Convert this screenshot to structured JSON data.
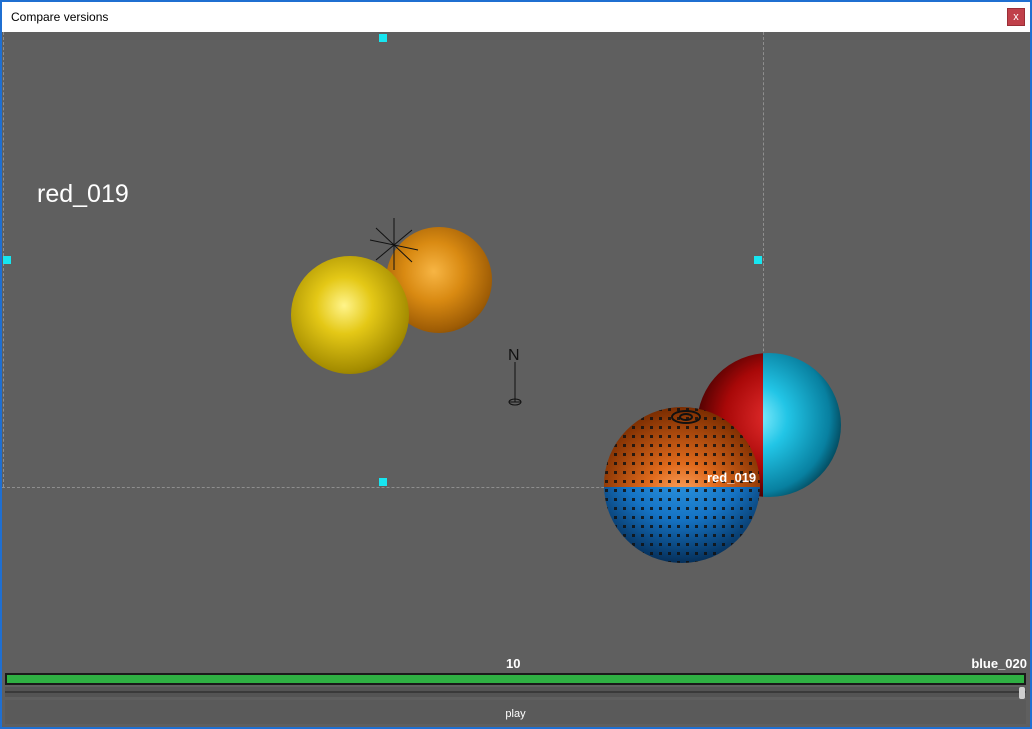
{
  "window": {
    "title": "Compare versions",
    "close_label": "x"
  },
  "viewport": {
    "object_label": "red_019",
    "sphere_label": "red_019",
    "compass_letter": "N"
  },
  "timeline": {
    "current_frame": "10",
    "end_label": "blue_020",
    "progress": 1.0,
    "slider_value": 1.0,
    "play_label": "play"
  },
  "colors": {
    "background": "#5f5f5f",
    "handle": "#17e6f0",
    "progress": "#2fb043",
    "accent_frame": "#1f6fd1"
  }
}
